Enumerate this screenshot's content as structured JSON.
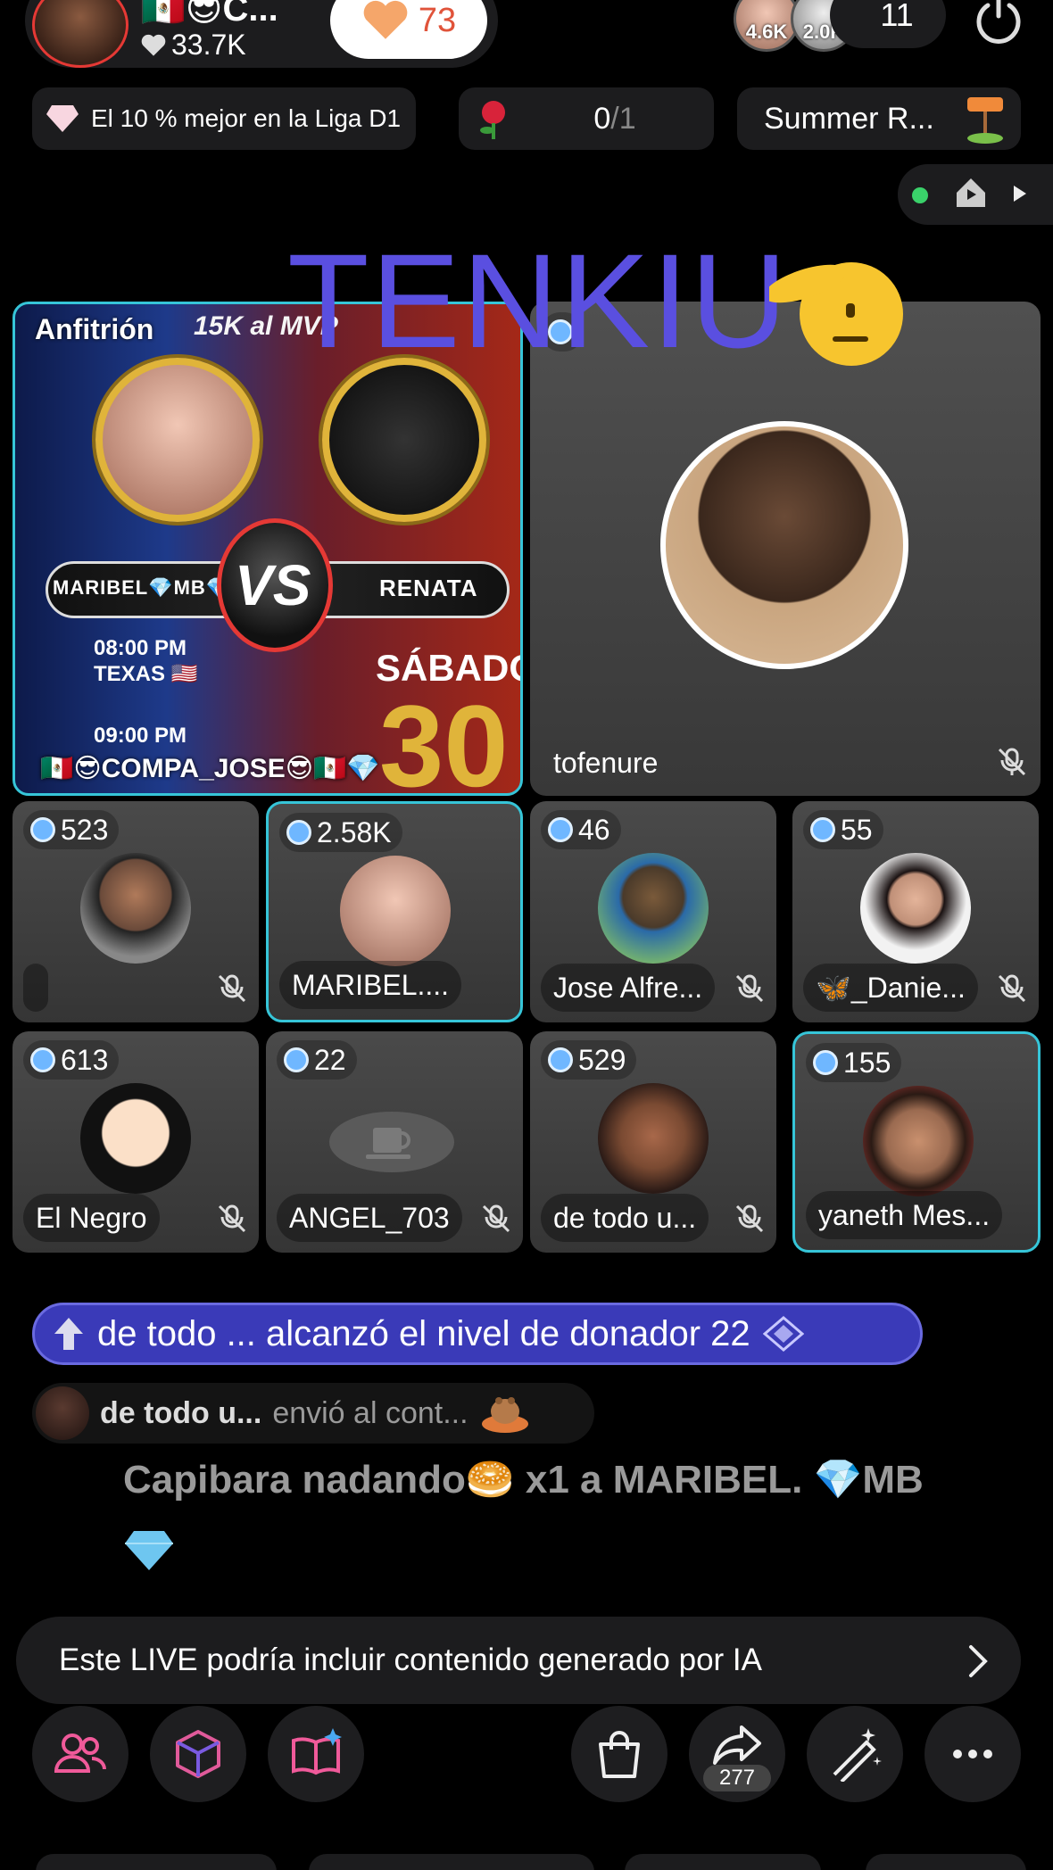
{
  "header": {
    "host_name": "🇲🇽😎C...",
    "host_likes": "33.7K",
    "follow_count": "73",
    "viewer_counts": [
      "4.6K",
      "2.0K"
    ],
    "viewer_total": "11"
  },
  "pills": {
    "rank_text": "El 10 % mejor en la Liga D1",
    "rose_current": "0",
    "rose_total": "/1",
    "summer_text": "Summer R..."
  },
  "overlay_text": "TENKIU",
  "host_tile": {
    "label": "Anfitrión",
    "poster_top": "15K al MVP",
    "poster_left_name": "MARIBEL💎MB💎",
    "poster_right_name": "RENATA",
    "poster_time1": "08:00 PM\nTEXAS 🇺🇸",
    "poster_time2": "09:00 PM",
    "poster_day": "SÁBADO",
    "poster_big": "30",
    "bottom_name": "🇲🇽😎COMPA_JOSE😎🇲🇽💎"
  },
  "guest_tile": {
    "name": "tofenure"
  },
  "small_tiles": [
    {
      "coins": "523",
      "name": ""
    },
    {
      "coins": "2.58K",
      "name": "MARIBEL...."
    },
    {
      "coins": "46",
      "name": "Jose Alfre..."
    },
    {
      "coins": "55",
      "name": "🦋_Danie..."
    },
    {
      "coins": "613",
      "name": "El Negro"
    },
    {
      "coins": "22",
      "name": "ANGEL_703"
    },
    {
      "coins": "529",
      "name": "de todo u..."
    },
    {
      "coins": "155",
      "name": "yaneth Mes..."
    }
  ],
  "chat": {
    "level_banner": "de todo ... alcanzó el nivel de donador 22",
    "gift_user": "de todo u...",
    "gift_action": "envió al cont...",
    "gift_line": "Capibara nadando🥯 x1 a MARIBEL. 💎MB"
  },
  "ai_notice": "Este LIVE podría incluir contenido generado por IA",
  "toolbar": {
    "share_count": "277",
    "icons": [
      "people-icon",
      "box-icon",
      "book-sparkle-icon",
      "bag-icon",
      "share-icon",
      "magic-wand-icon",
      "more-icon"
    ]
  },
  "colors": {
    "accent_teal": "#36c5d8",
    "banner_blue": "#3a3ab8",
    "overlay_purple": "#5a4fe0",
    "follow_orange": "#e0533a"
  }
}
